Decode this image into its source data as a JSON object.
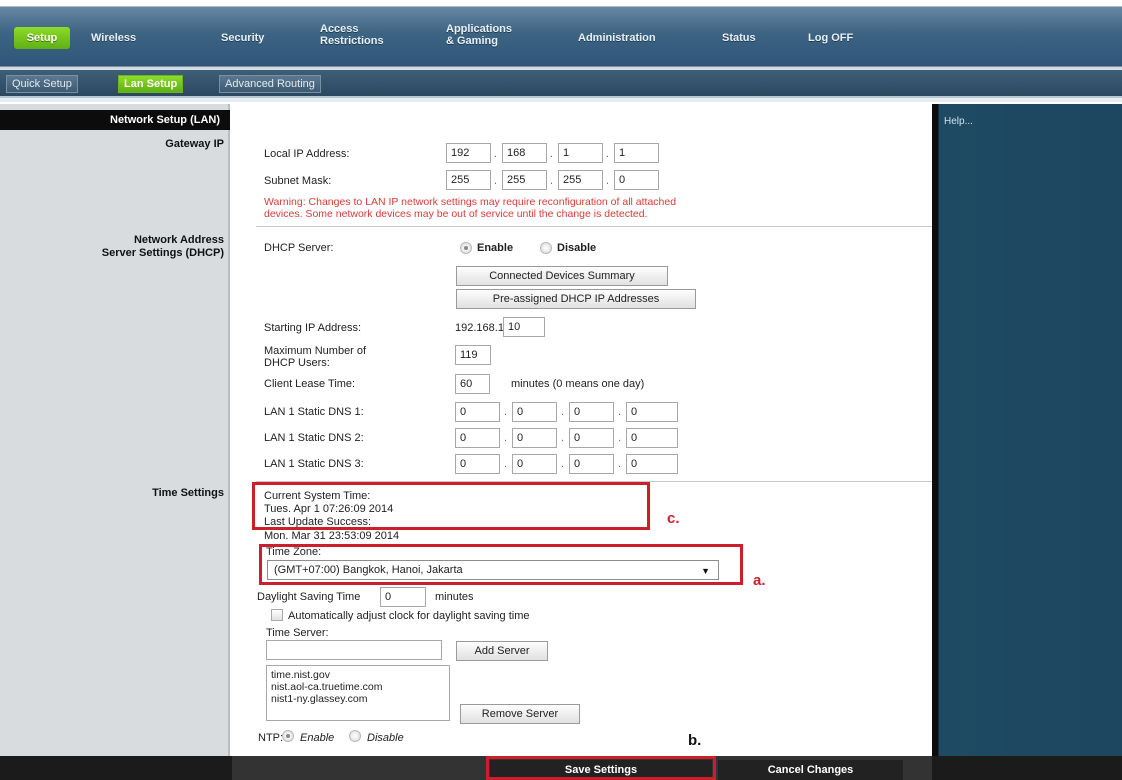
{
  "nav": {
    "setup": "Setup",
    "wireless": "Wireless",
    "security": "Security",
    "access_l1": "Access",
    "access_l2": "Restrictions",
    "apps_l1": "Applications",
    "apps_l2": "& Gaming",
    "administration": "Administration",
    "status": "Status",
    "logoff": "Log OFF"
  },
  "subtabs": {
    "quick": "Quick Setup",
    "lan": "Lan Setup",
    "advanced": "Advanced Routing"
  },
  "help": "Help...",
  "left": {
    "section_header": "Network Setup (LAN)",
    "gateway": "Gateway IP",
    "dhcp_l1": "Network Address",
    "dhcp_l2": "Server Settings (DHCP)",
    "time": "Time Settings"
  },
  "gateway": {
    "local_ip_label": "Local IP Address:",
    "local_ip": [
      "192",
      "168",
      "1",
      "1"
    ],
    "subnet_label": "Subnet Mask:",
    "subnet": [
      "255",
      "255",
      "255",
      "0"
    ],
    "warning_l1": "Warning: Changes to LAN IP network settings may require reconfiguration of all attached",
    "warning_l2": "devices. Some network devices may be out of service until the change is detected."
  },
  "dhcp": {
    "server_label": "DHCP Server:",
    "enable": "Enable",
    "disable": "Disable",
    "connected_btn": "Connected Devices Summary",
    "preassigned_btn": "Pre-assigned DHCP IP Addresses",
    "start_label": "Starting IP Address:",
    "start_prefix": "192.168.1.",
    "start_value": "10",
    "max_l1": "Maximum Number of",
    "max_l2": "DHCP Users:",
    "max_value": "119",
    "lease_label": "Client Lease Time:",
    "lease_value": "60",
    "lease_unit": "minutes (0 means one day)",
    "dns1_label": "LAN 1 Static DNS 1:",
    "dns2_label": "LAN 1 Static DNS 2:",
    "dns3_label": "LAN 1 Static DNS 3:",
    "dns1": [
      "0",
      "0",
      "0",
      "0"
    ],
    "dns2": [
      "0",
      "0",
      "0",
      "0"
    ],
    "dns3": [
      "0",
      "0",
      "0",
      "0"
    ]
  },
  "time": {
    "current_label": "Current System Time:",
    "current_value": "Tues. Apr 1 07:26:09 2014",
    "last_label": "Last Update Success:",
    "last_value": "Mon. Mar 31 23:53:09 2014",
    "zone_label": "Time Zone:",
    "zone_value": "(GMT+07:00) Bangkok, Hanoi, Jakarta",
    "dst_label": "Daylight Saving Time",
    "dst_value": "0",
    "dst_unit": "minutes",
    "auto_label": "Automatically adjust clock for daylight saving time",
    "server_label": "Time Server:",
    "server_input": "",
    "add_btn": "Add Server",
    "servers": [
      "time.nist.gov",
      "nist.aol-ca.truetime.com",
      "nist1-ny.glassey.com"
    ],
    "remove_btn": "Remove Server",
    "ntp_label": "NTP:",
    "ntp_enable": "Enable",
    "ntp_disable": "Disable"
  },
  "annotations": {
    "a": "a.",
    "b": "b.",
    "c": "c."
  },
  "footer": {
    "save": "Save Settings",
    "cancel": "Cancel Changes"
  },
  "colors": {
    "accent_green": "#6db320",
    "nav_blue": "#3d6482",
    "annotation_red": "#cc1f2a",
    "warning_red": "#d93b3b"
  }
}
